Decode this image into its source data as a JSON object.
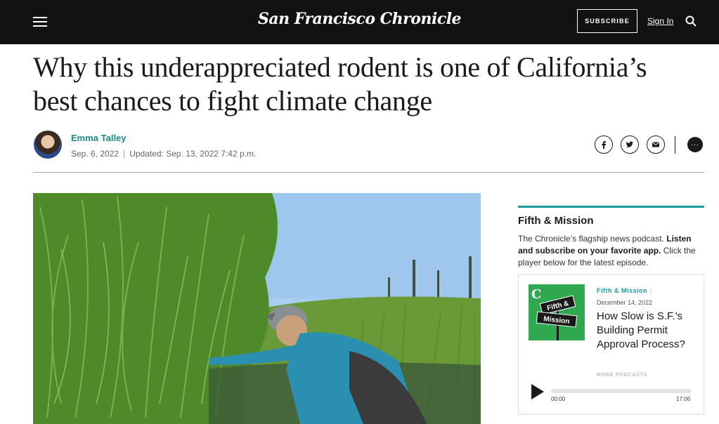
{
  "header": {
    "logo": "San Francisco Chronicle",
    "subscribe_label": "SUBSCRIBE",
    "signin_label": "Sign In",
    "menu_icon": "hamburger-menu-icon",
    "search_icon": "search-icon"
  },
  "article": {
    "headline": "Why this underappreciated rodent is one of California’s best chances to fight climate change",
    "author": "Emma Talley",
    "published": "Sep. 6, 2022",
    "separator": "|",
    "updated": "Updated: Sep. 13, 2022 7:42 p.m.",
    "share": [
      "facebook-icon",
      "twitter-icon",
      "email-icon"
    ],
    "comments_icon": "comments-icon"
  },
  "sidebar": {
    "title": "Fifth & Mission",
    "desc_start": "The Chronicle’s flagship news podcast. ",
    "desc_bold": "Listen and subscribe on your favorite app.",
    "desc_end": " Click the player below for the latest episode.",
    "player": {
      "art_line1": "Fifth &",
      "art_line2": "Mission",
      "show": "Fifth & Mission",
      "show_sep": "|",
      "date": "December 14, 2022",
      "episode": "How Slow is S.F.'s Building Permit Approval Process?",
      "more": "MORE PODCASTS",
      "time_start": "00:00",
      "time_end": "17:06",
      "progress": 0
    }
  },
  "colors": {
    "accent": "#1a9aa0",
    "author": "#1a8a8c",
    "header_bg": "#121212"
  }
}
